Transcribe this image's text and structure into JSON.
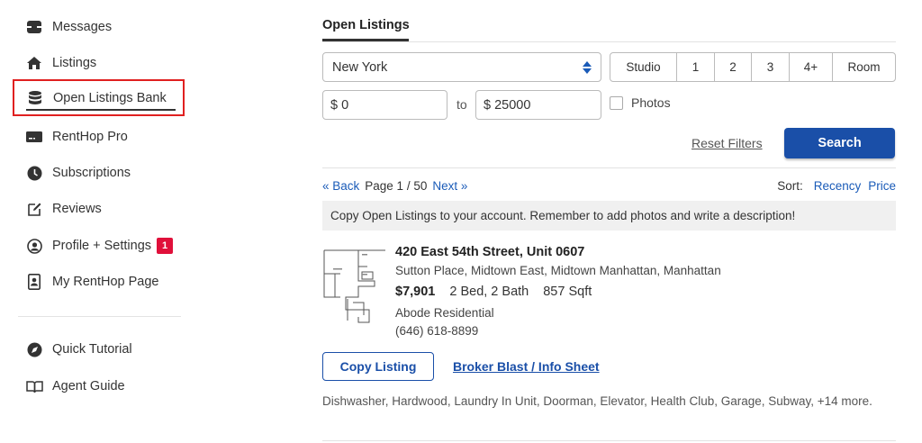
{
  "sidebar": {
    "items": [
      {
        "label": "Messages",
        "icon": "inbox-icon"
      },
      {
        "label": "Listings",
        "icon": "home-icon"
      },
      {
        "label": "Open Listings Bank",
        "icon": "database-icon",
        "active": true
      },
      {
        "label": "RentHop Pro",
        "icon": "pro-card-icon"
      },
      {
        "label": "Subscriptions",
        "icon": "clock-icon"
      },
      {
        "label": "Reviews",
        "icon": "edit-icon"
      },
      {
        "label": "Profile + Settings",
        "icon": "user-circle-icon",
        "badge": "1"
      },
      {
        "label": "My RentHop Page",
        "icon": "badge-id-icon"
      }
    ],
    "help_items": [
      {
        "label": "Quick Tutorial",
        "icon": "compass-icon"
      },
      {
        "label": "Agent Guide",
        "icon": "book-open-icon"
      }
    ]
  },
  "main": {
    "tab_label": "Open Listings",
    "city_select": {
      "value": "New York"
    },
    "bed_options": [
      "Studio",
      "1",
      "2",
      "3",
      "4+",
      "Room"
    ],
    "price_min": "$ 0",
    "price_to_label": "to",
    "price_max": "$ 25000",
    "photos_label": "Photos",
    "reset_label": "Reset Filters",
    "search_label": "Search",
    "pager": {
      "back": "« Back",
      "page": "Page 1 / 50",
      "next": "Next »"
    },
    "sort": {
      "label": "Sort:",
      "recency": "Recency",
      "price": "Price"
    },
    "notice": "Copy Open Listings to your account. Remember to add photos and write a description!",
    "listing": {
      "address": "420 East 54th Street, Unit 0607",
      "neighborhood": "Sutton Place, Midtown East, Midtown Manhattan, Manhattan",
      "price": "$7,901",
      "beds_baths": "2 Bed, 2 Bath",
      "sqft": "857 Sqft",
      "broker": "Abode Residential",
      "phone": "(646) 618-8899",
      "copy_label": "Copy Listing",
      "blast_label": "Broker Blast / Info Sheet",
      "amenities": "Dishwasher, Hardwood, Laundry In Unit, Doorman, Elevator, Health Club, Garage, Subway, +14 more."
    }
  },
  "colors": {
    "accent": "#1a4fa8",
    "link": "#1a5bb8",
    "badge": "#e0103a",
    "highlight_border": "#e02020"
  }
}
